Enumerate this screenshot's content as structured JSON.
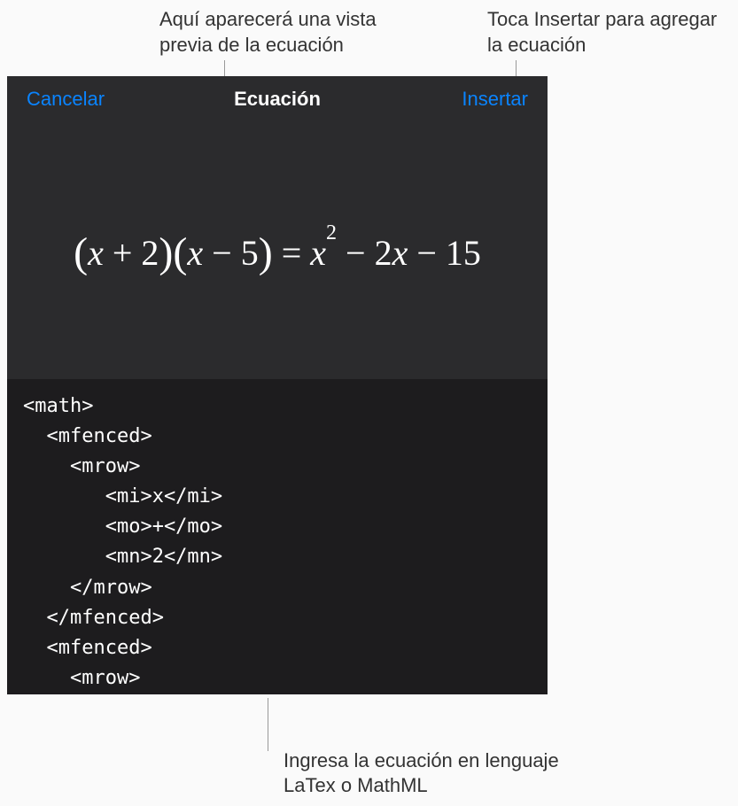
{
  "callouts": {
    "preview": "Aquí aparecerá una vista previa de la ecuación",
    "insert": "Toca Insertar para agregar la ecuación",
    "input": "Ingresa la ecuación en lenguaje LaTex o MathML"
  },
  "header": {
    "cancel_label": "Cancelar",
    "title": "Ecuación",
    "insert_label": "Insertar"
  },
  "equation_preview": {
    "rendered": "(x + 2)(x − 5) = x² − 2x − 15"
  },
  "code_input": {
    "content": "<math>\n  <mfenced>\n    <mrow>\n       <mi>x</mi>\n       <mo>+</mo>\n       <mn>2</mn>\n    </mrow>\n  </mfenced>\n  <mfenced>\n    <mrow>"
  },
  "colors": {
    "accent": "#0a84ff",
    "preview_bg": "#2b2b2d",
    "code_bg": "#1d1c1e"
  }
}
